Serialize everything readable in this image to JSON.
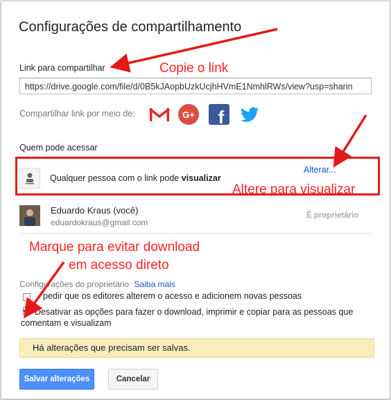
{
  "dialog": {
    "title": "Configurações de compartilhamento",
    "link_label": "Link para compartilhar",
    "link_value": "https://drive.google.com/file/d/0B5kJAopbUzkUcjhHVmE1NmhlRWs/view?usp=sharin",
    "share_via_label": "Compartilhar link por meio de:",
    "who_access_label": "Quem pode acessar",
    "access_text_prefix": "Qualquer pessoa com o link pode ",
    "access_text_bold": "visualizar",
    "change_link": "Alterar...",
    "owner_name": "Eduardo Kraus (você)",
    "owner_email": "eduardokraus@gmail.com",
    "owner_role": "É proprietário",
    "owner_settings_label": "Configurações do proprietário",
    "learn_more": "Saiba mais",
    "option1": "pedir que os editores alterem o acesso e adicionem novas pessoas",
    "option1_checked": false,
    "option2_line1": "Desativar as opções para fazer o download, imprimir e copiar para as pessoas que",
    "option2_line2": "comentam e visualizam",
    "option2_checked": true,
    "warning": "Há alterações que precisam ser salvas.",
    "save_button": "Salvar alterações",
    "cancel_button": "Cancelar"
  },
  "annotations": {
    "copy_link": "Copie o link",
    "change_view": "Altere para visualizar",
    "mark_line1": "Marque para evitar download",
    "mark_line2": "em acesso direto"
  },
  "social_icons": [
    "gmail-icon",
    "google-plus-icon",
    "facebook-icon",
    "twitter-icon"
  ],
  "colors": {
    "accent": "#4d90fe",
    "annotation_red": "#e41a1a",
    "link_blue": "#1155cc",
    "warning_bg": "#f9edbe"
  }
}
